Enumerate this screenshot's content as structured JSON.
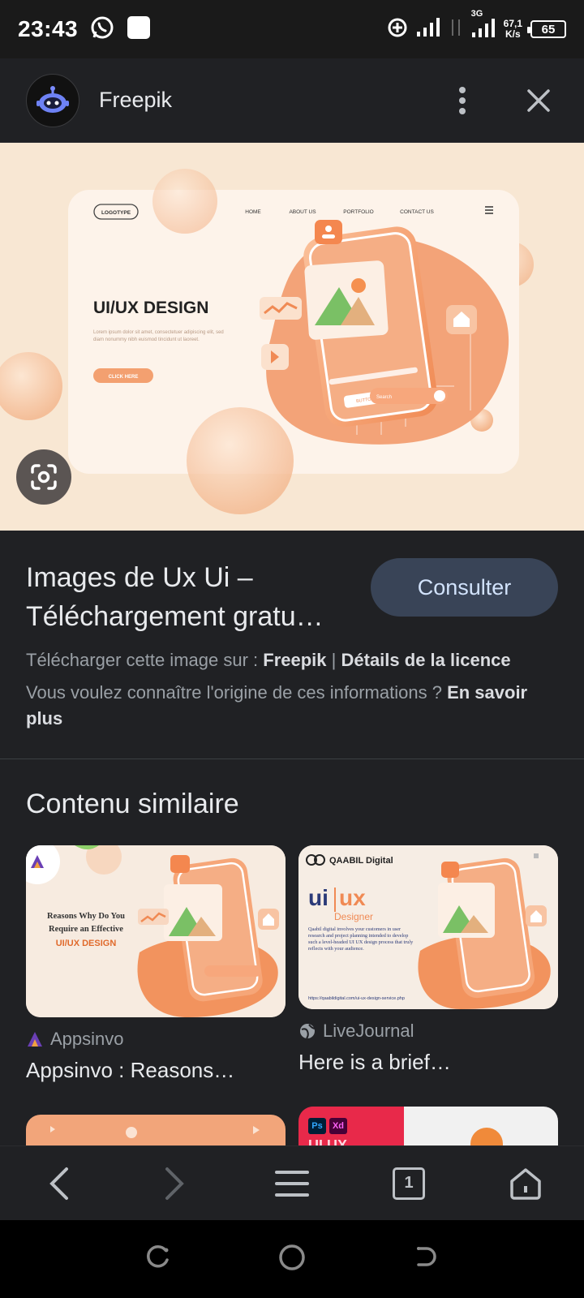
{
  "status": {
    "time": "23:43",
    "network": "3G",
    "speed_value": "67,1",
    "speed_unit": "K/s",
    "battery": "65"
  },
  "header": {
    "title": "Freepik"
  },
  "hero": {
    "logo_text": "LOGOTYPE",
    "nav": [
      "HOME",
      "ABOUT US",
      "PORTFOLIO",
      "CONTACT US"
    ],
    "headline": "UI/UX DESIGN",
    "body_text": "Lorem ipsum dolor sit amet, consectetuer adipiscing elit, sed diam nonummy nibh euismod tincidunt ut laoreet.",
    "cta": "CLICK HERE",
    "phone_button": "BUTTON",
    "phone_search": "Search"
  },
  "details": {
    "title": "Images de Ux Ui – Téléchargement gratu…",
    "consult_label": "Consulter",
    "download_prefix": "Télécharger cette image sur :",
    "download_source": "Freepik",
    "separator": "|",
    "license_label": "Détails de la licence",
    "origin_question": "Vous voulez connaître l'origine de ces informations ?",
    "learn_more": "En savoir plus"
  },
  "similar": {
    "heading": "Contenu similaire",
    "cards": [
      {
        "source": "Appsinvo",
        "caption": "Appsinvo : Reasons…",
        "thumb_line1": "Reasons Why Do You",
        "thumb_line2": "Require an Effective",
        "thumb_line3": "UI/UX DESIGN"
      },
      {
        "source": "LiveJournal",
        "caption": "Here is a brief…",
        "thumb_brand": "QAABIL Digital",
        "thumb_ui": "ui",
        "thumb_ux": "ux",
        "thumb_sub": "Designer",
        "thumb_body": "Qaabil digital involves your customers in user research and project planning intended to develop such a level-headed UI UX design process that truly reflects with your audience.",
        "thumb_url": "https://qaabildigital.com/ui-ux-design-service.php"
      }
    ],
    "peek_labels": [
      "Ps",
      "Xd",
      "UI UX"
    ]
  },
  "bottombar": {
    "tab_count": "1"
  },
  "colors": {
    "background": "#202124",
    "accent_button": "#394457",
    "hero_bg": "#f8e7d3",
    "orange": "#f2935e"
  }
}
